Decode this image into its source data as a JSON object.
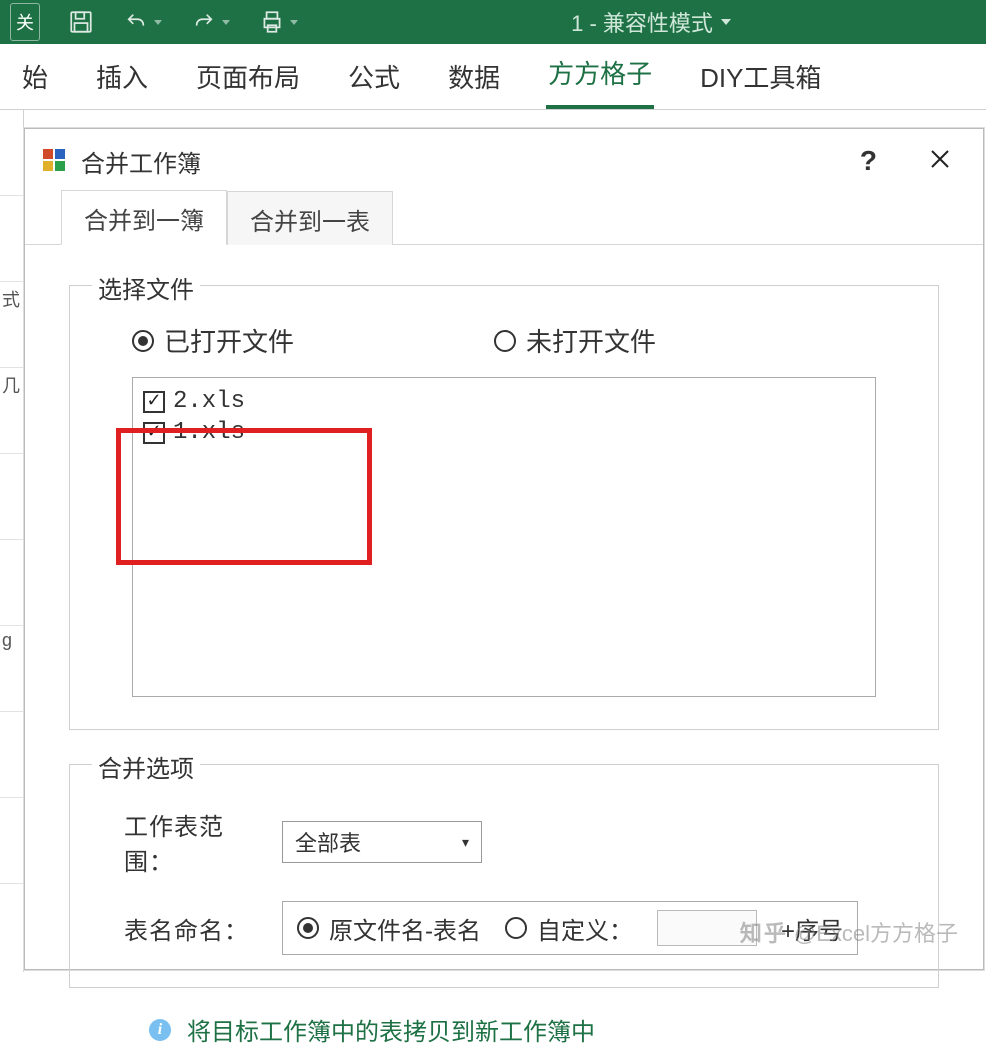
{
  "titlebar": {
    "close_btn": "关",
    "doc_title": "1 - 兼容性模式"
  },
  "ribbon": {
    "tabs": [
      "始",
      "插入",
      "页面布局",
      "公式",
      "数据",
      "方方格子",
      "DIY工具箱"
    ],
    "active_index": 5
  },
  "gutter": [
    "",
    "",
    "式",
    "几",
    "",
    "",
    "g",
    "",
    "",
    ""
  ],
  "dialog": {
    "title": "合并工作簿",
    "tabs": [
      "合并到一簿",
      "合并到一表"
    ],
    "active_tab": 0,
    "select_files": {
      "legend": "选择文件",
      "radio_opened": "已打开文件",
      "radio_unopened": "未打开文件",
      "radio_checked": "opened",
      "files": [
        {
          "name": "2.xls",
          "checked": true
        },
        {
          "name": "1.xls",
          "checked": true
        }
      ]
    },
    "merge_options": {
      "legend": "合并选项",
      "sheet_range_label": "工作表范围：",
      "sheet_range_value": "全部表",
      "naming_label": "表名命名：",
      "naming_radio_original": "原文件名-表名",
      "naming_radio_custom": "自定义：",
      "naming_suffix": "+序号",
      "naming_selected": "original"
    },
    "info_text": "将目标工作簿中的表拷贝到新工作簿中"
  },
  "watermark": {
    "logo": "知乎",
    "text": "@Excel方方格子"
  }
}
